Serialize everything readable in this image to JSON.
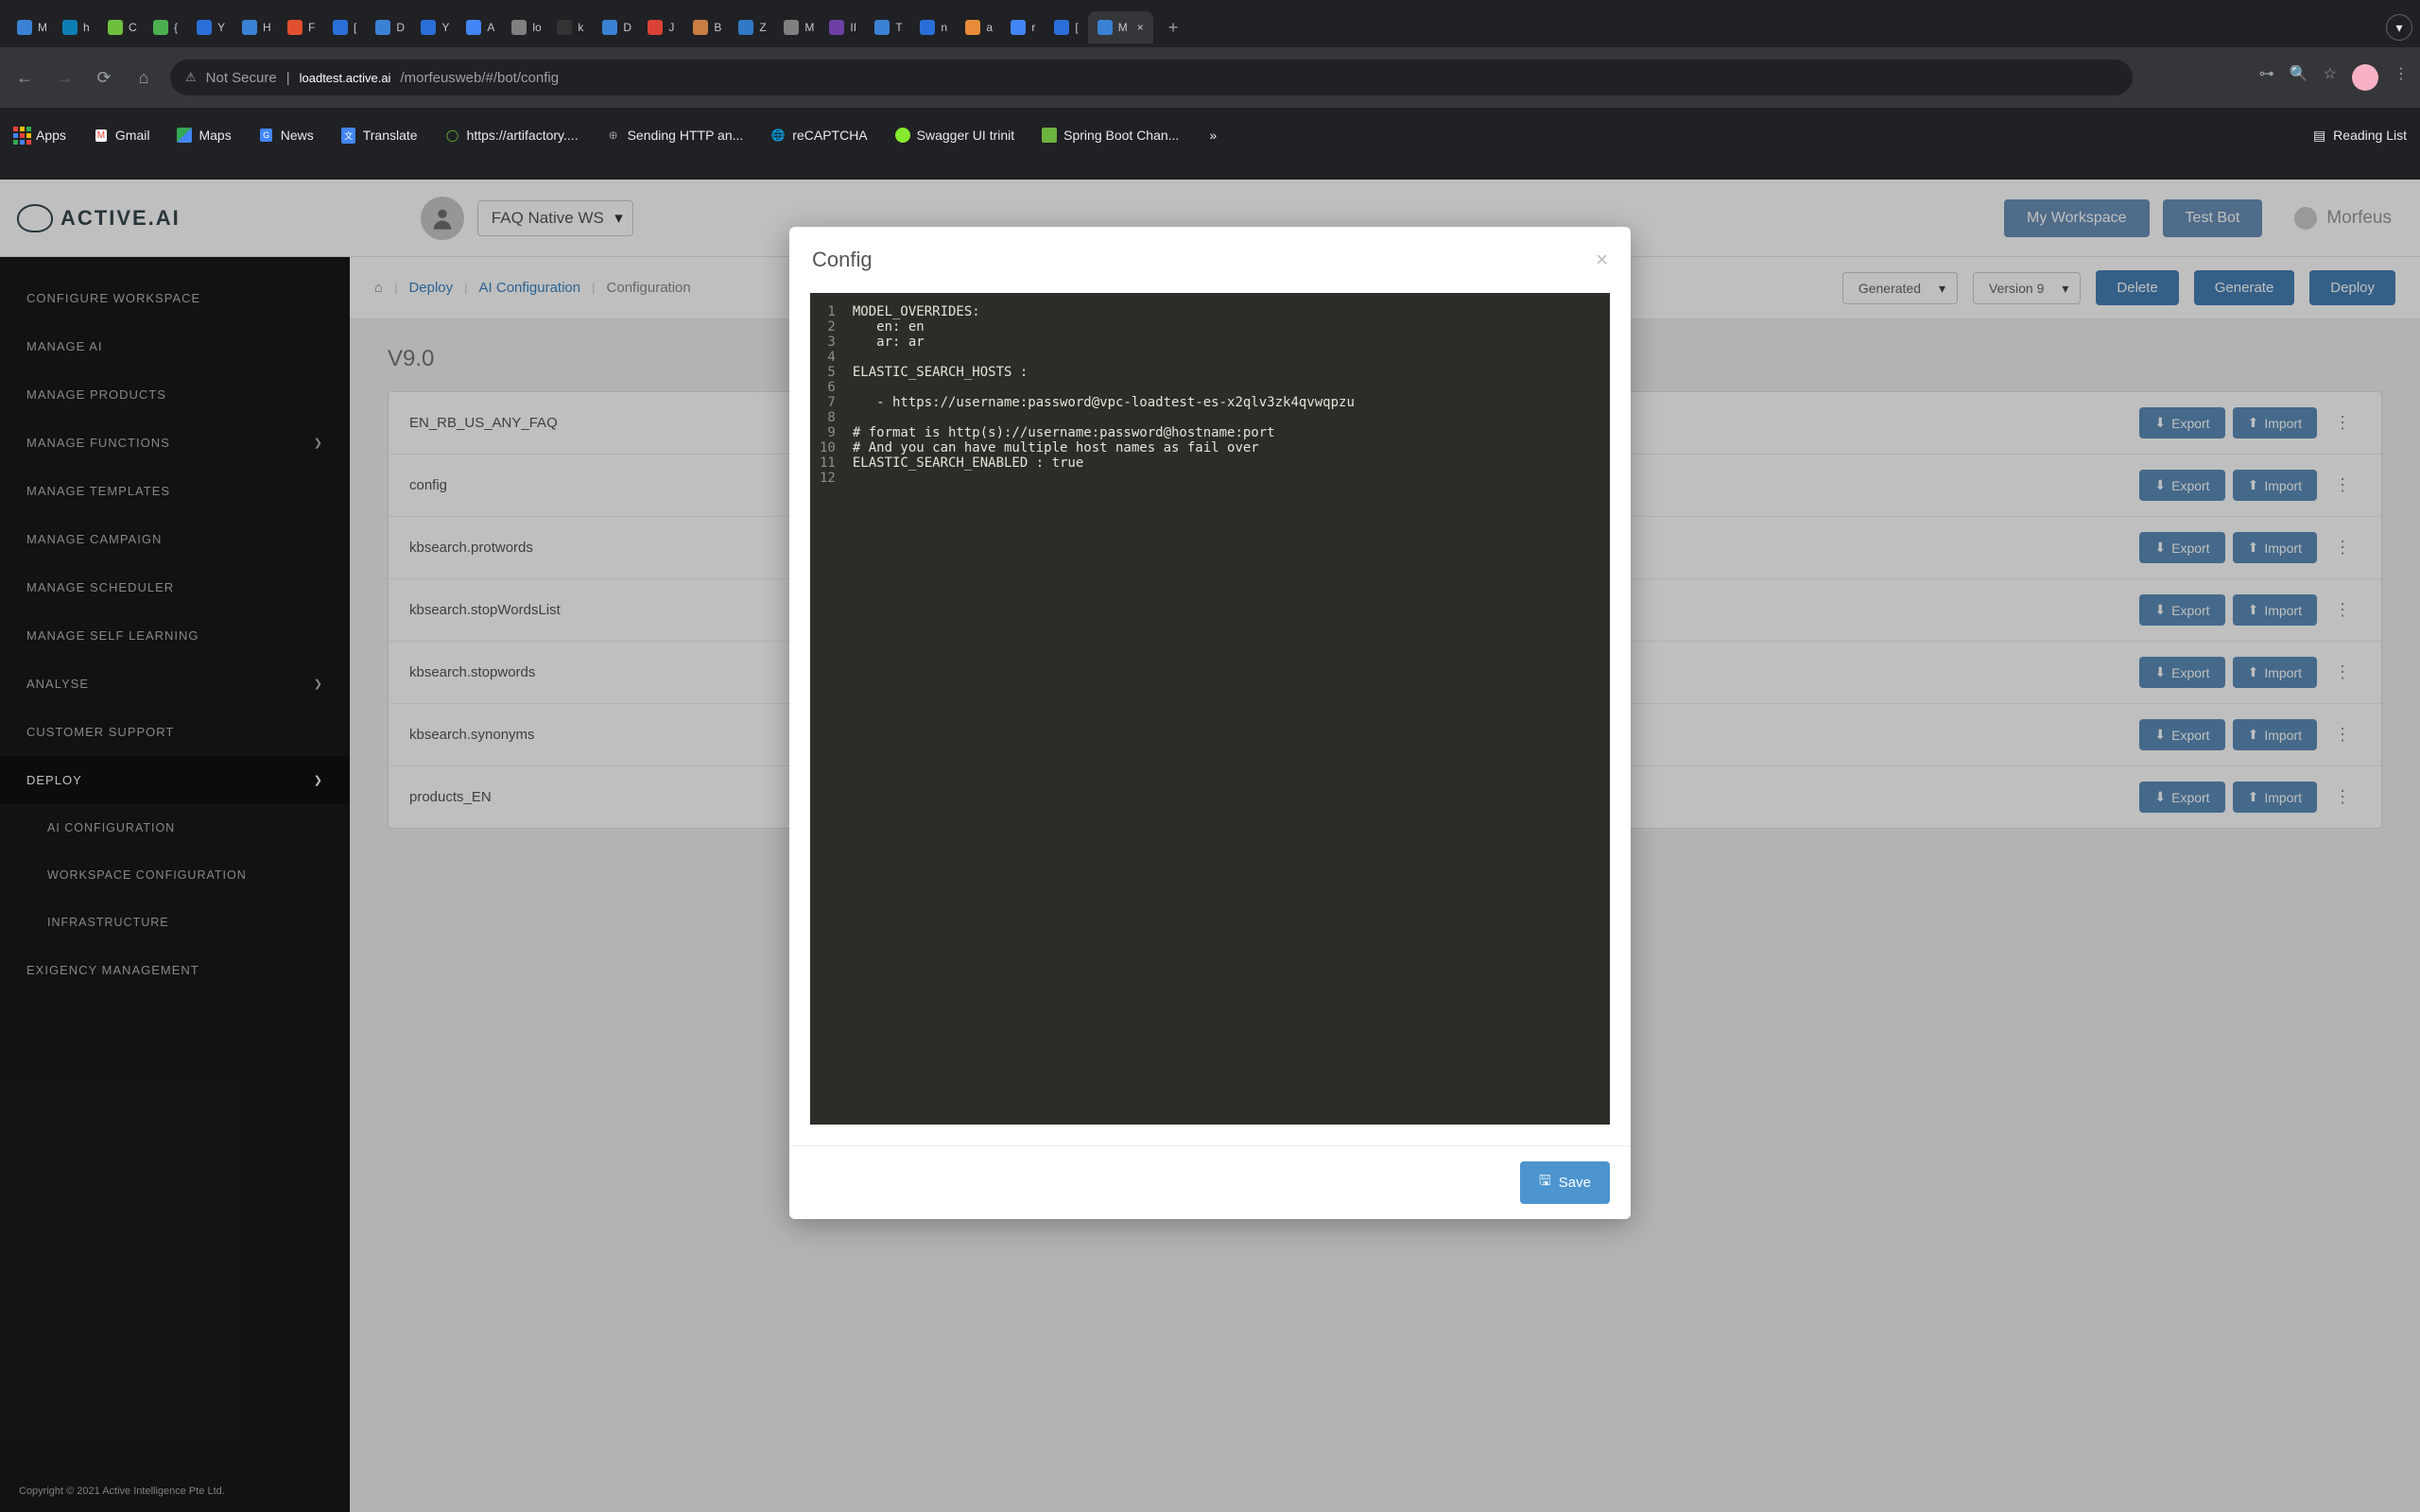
{
  "browser": {
    "tabs": [
      "M",
      "h",
      "C",
      "{",
      "Y",
      "H",
      "F",
      "[",
      "D",
      "Y",
      "A",
      "lo",
      "k",
      "D",
      "J",
      "B",
      "Z",
      "M",
      "II",
      "T",
      "n",
      "a",
      "r",
      "[",
      "M"
    ],
    "active_tab": 24,
    "new_tab": "+",
    "back": "←",
    "forward": "→",
    "reload": "⟳",
    "home": "⌂",
    "not_secure_icon": "⚠",
    "not_secure": "Not Secure",
    "url_pipe": "|",
    "url_host": "loadtest.active.ai",
    "url_path": "/morfeusweb/#/bot/config",
    "key_icon": "⊶",
    "search_icon": "🔍",
    "star_icon": "☆",
    "menu_icon": "⋮",
    "chevrons": "»"
  },
  "bookmarks": {
    "items": [
      {
        "icon": "grid",
        "label": "Apps"
      },
      {
        "icon": "mail",
        "label": "Gmail"
      },
      {
        "icon": "maps",
        "label": "Maps"
      },
      {
        "icon": "news",
        "label": "News"
      },
      {
        "icon": "trans",
        "label": "Translate"
      },
      {
        "icon": "art",
        "label": "https://artifactory...."
      },
      {
        "icon": "http",
        "label": "Sending HTTP an..."
      },
      {
        "icon": "re",
        "label": "reCAPTCHA"
      },
      {
        "icon": "swag",
        "label": "Swagger UI trinit"
      },
      {
        "icon": "spring",
        "label": "Spring Boot Chan..."
      }
    ],
    "reading": "Reading List"
  },
  "topbar": {
    "brand": "ACTIVE.AI",
    "workspace": "FAQ Native WS",
    "my_ws": "My Workspace",
    "test_bot": "Test Bot",
    "user": "Morfeus"
  },
  "sidebar": {
    "items": [
      {
        "label": "CONFIGURE WORKSPACE"
      },
      {
        "label": "MANAGE AI"
      },
      {
        "label": "MANAGE PRODUCTS"
      },
      {
        "label": "MANAGE FUNCTIONS",
        "chev": true
      },
      {
        "label": "MANAGE TEMPLATES"
      },
      {
        "label": "MANAGE CAMPAIGN"
      },
      {
        "label": "MANAGE SCHEDULER"
      },
      {
        "label": "MANAGE SELF LEARNING"
      },
      {
        "label": "ANALYSE",
        "chev": true
      },
      {
        "label": "CUSTOMER SUPPORT"
      },
      {
        "label": "DEPLOY",
        "chev": true,
        "active": true
      }
    ],
    "subs": [
      {
        "label": "AI CONFIGURATION"
      },
      {
        "label": "WORKSPACE CONFIGURATION"
      },
      {
        "label": "INFRASTRUCTURE"
      }
    ],
    "subs2": [
      {
        "label": "EXIGENCY MANAGEMENT"
      }
    ],
    "footer": "Copyright © 2021 Active Intelligence Pte Ltd."
  },
  "breadcrumbs": {
    "home": "⌂",
    "items": [
      "Deploy",
      "AI Configuration",
      "Configuration"
    ],
    "sel1": "Generated",
    "sel2": "Version 9",
    "delete": "Delete",
    "generate": "Generate",
    "deploy": "Deploy"
  },
  "main": {
    "version": "V9.0",
    "rows": [
      {
        "name": "EN_RB_US_ANY_FAQ"
      },
      {
        "name": "config"
      },
      {
        "name": "kbsearch.protwords"
      },
      {
        "name": "kbsearch.stopWordsList"
      },
      {
        "name": "kbsearch.stopwords"
      },
      {
        "name": "kbsearch.synonyms"
      },
      {
        "name": "products_EN"
      }
    ],
    "export": "Export",
    "import": "Import"
  },
  "modal": {
    "title": "Config",
    "close": "×",
    "lines": [
      "MODEL_OVERRIDES:",
      "   en: en",
      "   ar: ar",
      "",
      "ELASTIC_SEARCH_HOSTS :",
      "",
      "   - https://username:password@vpc-loadtest-es-x2qlv3zk4qvwqpzu",
      "",
      "# format is http(s)://username:password@hostname:port",
      "# And you can have multiple host names as fail over",
      "ELASTIC_SEARCH_ENABLED : true",
      ""
    ],
    "save": "Save",
    "save_icon": "🖫"
  }
}
